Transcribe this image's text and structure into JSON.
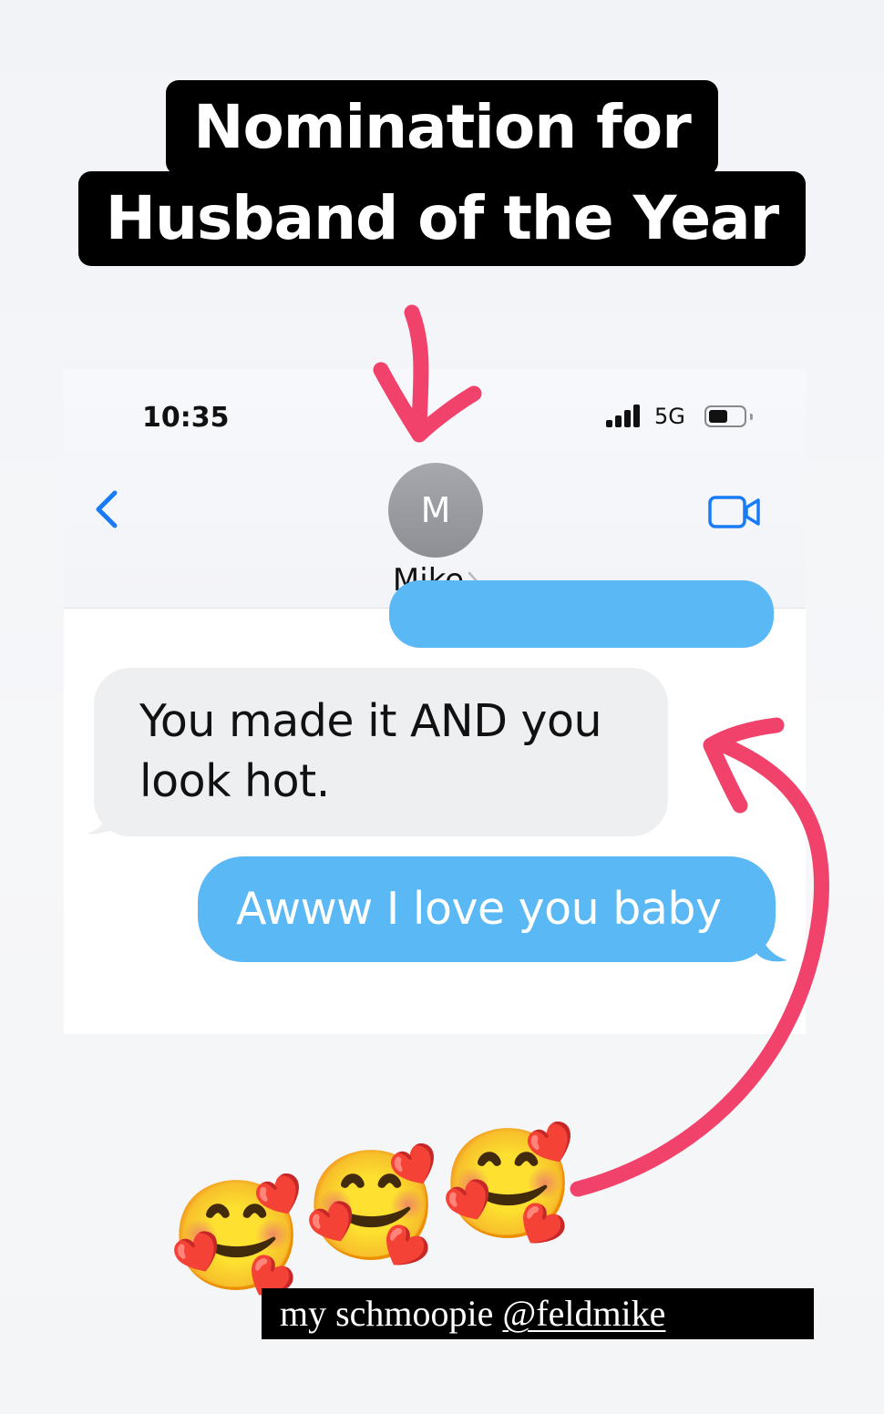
{
  "headline": {
    "line1": "Nomination for",
    "line2": "Husband of the Year"
  },
  "status_bar": {
    "time": "10:35",
    "network": "5G",
    "icons": [
      "signal-bars-icon",
      "battery-icon"
    ]
  },
  "conversation_header": {
    "avatar_initial": "M",
    "contact_name": "Mike",
    "icons": [
      "back-chevron-icon",
      "video-call-icon",
      "contact-chevron-icon"
    ]
  },
  "messages": [
    {
      "direction": "incoming",
      "text": "You made it AND you look hot."
    },
    {
      "direction": "outgoing",
      "text": "Awww I love you baby"
    }
  ],
  "message_lines": {
    "incoming_line1": "You made it AND you",
    "incoming_line2": "look hot."
  },
  "emojis": {
    "glyph": "🥰",
    "name": "smiling-face-with-hearts-icon",
    "count": 3
  },
  "caption": {
    "prefix": "my schmoopie",
    "mention": "@feldmike"
  },
  "colors": {
    "outgoing_bubble": "#5ab8f5",
    "incoming_bubble": "#eeeff1",
    "annotation_arrow": "#f0426a",
    "ios_blue": "#1a7cf4"
  }
}
